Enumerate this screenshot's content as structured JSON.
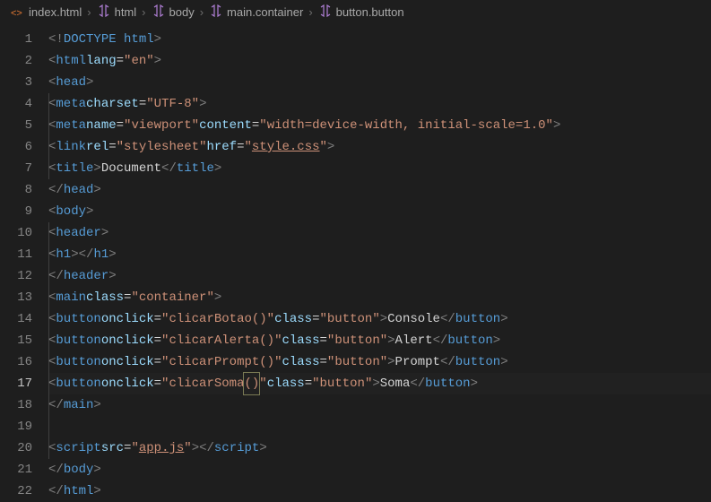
{
  "breadcrumbs": {
    "file": "index.html",
    "items": [
      "html",
      "body",
      "main.container",
      "button.button"
    ]
  },
  "lines": [
    1,
    2,
    3,
    4,
    5,
    6,
    7,
    8,
    9,
    10,
    11,
    12,
    13,
    14,
    15,
    16,
    17,
    18,
    19,
    20,
    21,
    22
  ],
  "activeLine": 17,
  "code": {
    "doctype": "DOCTYPE html",
    "html": "html",
    "head": "head",
    "body": "body",
    "meta": "meta",
    "link": "link",
    "title": "title",
    "header": "header",
    "h1": "h1",
    "main": "main",
    "button": "button",
    "script": "script",
    "attr_lang": "lang",
    "val_lang": "en",
    "attr_charset": "charset",
    "val_charset": "UTF-8",
    "attr_name": "name",
    "val_viewport": "viewport",
    "attr_content": "content",
    "val_content": "width=device-width, initial-scale=1.0",
    "attr_rel": "rel",
    "val_rel": "stylesheet",
    "attr_href": "href",
    "val_href": "style.css",
    "title_text": "Document",
    "attr_class": "class",
    "val_container": "container",
    "attr_onclick": "onclick",
    "val_click1": "clicarBotao()",
    "val_click2": "clicarAlerta()",
    "val_click3": "clicarPrompt()",
    "val_click4_a": "clicarSoma",
    "val_click4_b": "()",
    "val_button_cls": "button",
    "btn1_text": "Console",
    "btn2_text": "Alert",
    "btn3_text": "Prompt",
    "btn4_text": "Soma",
    "attr_src": "src",
    "val_src": "app.js"
  }
}
